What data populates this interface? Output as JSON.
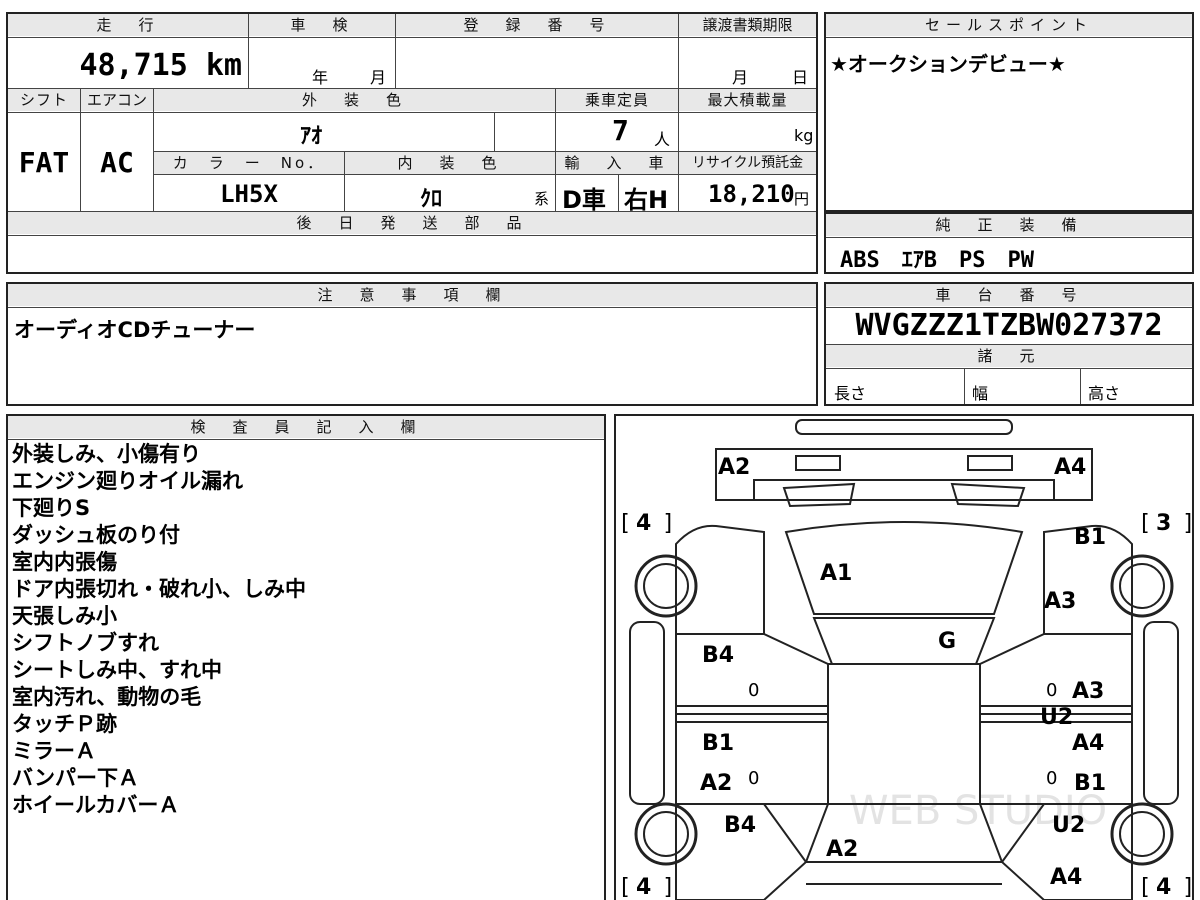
{
  "top_header": {
    "mileage_label": "走　行",
    "shaken_label": "車　検",
    "reg_label": "登　録　番　号",
    "transfer_label": "譲渡書類期限",
    "sales_label": "セールスポイント"
  },
  "top_values": {
    "mileage": "48,715 km",
    "shaken_year": "年",
    "shaken_month": "月",
    "transfer_month": "月",
    "transfer_day": "日",
    "sales_point": "★オークションデビュー★"
  },
  "second_header": {
    "shift_label": "シフト",
    "ac_label": "エアコン",
    "exterior_label": "外　装　色",
    "capacity_label": "乗車定員",
    "load_label": "最大積載量"
  },
  "vehicle": {
    "shift": "FAT",
    "ac": "AC",
    "exterior_color": "ｱｵ",
    "capacity": "7",
    "capacity_unit": "人",
    "load_unit": "kg",
    "color_no_label": "カ　ラ　ー　No．",
    "interior_label": "内　装　色",
    "import_label": "輸　入　車",
    "recycle_label": "リサイクル預託金",
    "color_no": "LH5X",
    "interior_color": "ｸﾛ",
    "interior_suffix": "系",
    "import_type": "D車",
    "steering": "右H",
    "recycle_fee": "18,210",
    "recycle_unit": "円"
  },
  "later_parts": {
    "label": "後　日　発　送　部　品",
    "value": ""
  },
  "equipment": {
    "label": "純　正　装　備",
    "value": "ABS　ｴｱB　PS　PW"
  },
  "caution": {
    "label": "注　意　事　項　欄",
    "value": "オーディオCDチューナー"
  },
  "chassis": {
    "label": "車　台　番　号",
    "number": "WVGZZZ1TZBW027372",
    "spec_label": "諸　元",
    "length_label": "長さ",
    "width_label": "幅",
    "height_label": "高さ"
  },
  "inspector": {
    "label": "検　査　員　記　入　欄",
    "notes": [
      "外装しみ、小傷有り",
      "エンジン廻りオイル漏れ",
      "下廻りS",
      "ダッシュ板のり付",
      "室内内張傷",
      "ドア内張切れ・破れ小、しみ中",
      "天張しみ小",
      "シフトノブすれ",
      "シートしみ中、すれ中",
      "室内汚れ、動物の毛",
      "タッチＰ跡",
      "ミラーＡ",
      "バンパー下Ａ",
      "ホイールカバーＡ"
    ]
  },
  "diagram": {
    "marks": {
      "front_left": "A2",
      "front_right": "A4",
      "hood": "A1",
      "fender_right": "B1",
      "fender_right_2": "A3",
      "windshield": "G",
      "door_fl": "B4",
      "door_rr_1": "A3",
      "door_rr_2": "U2",
      "door_rl_1": "B1",
      "door_rl_2": "A2",
      "door_rr_3": "A4",
      "door_rr_4": "B1",
      "rear_left": "B4",
      "rear_center": "A2",
      "rear_right_1": "U2",
      "rear_right_2": "A4"
    },
    "tires": {
      "front_left": "4",
      "front_right": "3",
      "rear_left": "4",
      "rear_right": "4"
    },
    "zero": "0",
    "watermark": "WEB STUDIO"
  }
}
